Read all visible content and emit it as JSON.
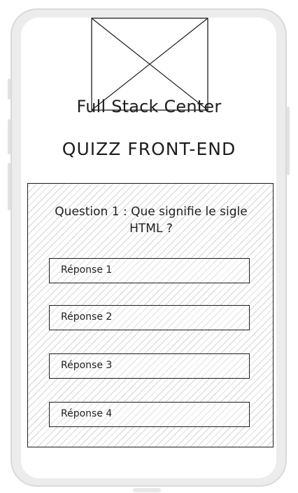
{
  "header": {
    "brand": "Full Stack Center",
    "title": "QUIZZ FRONT-END"
  },
  "quiz": {
    "question": "Question 1 : Que signifie le sigle HTML ?",
    "answers": [
      {
        "label": "Réponse 1"
      },
      {
        "label": "Réponse 2"
      },
      {
        "label": "Réponse 3"
      },
      {
        "label": "Réponse 4"
      }
    ]
  },
  "colors": {
    "ink": "#1e1e1e",
    "frame": "#d9d9d9",
    "hatch": "#d4d4d4"
  }
}
